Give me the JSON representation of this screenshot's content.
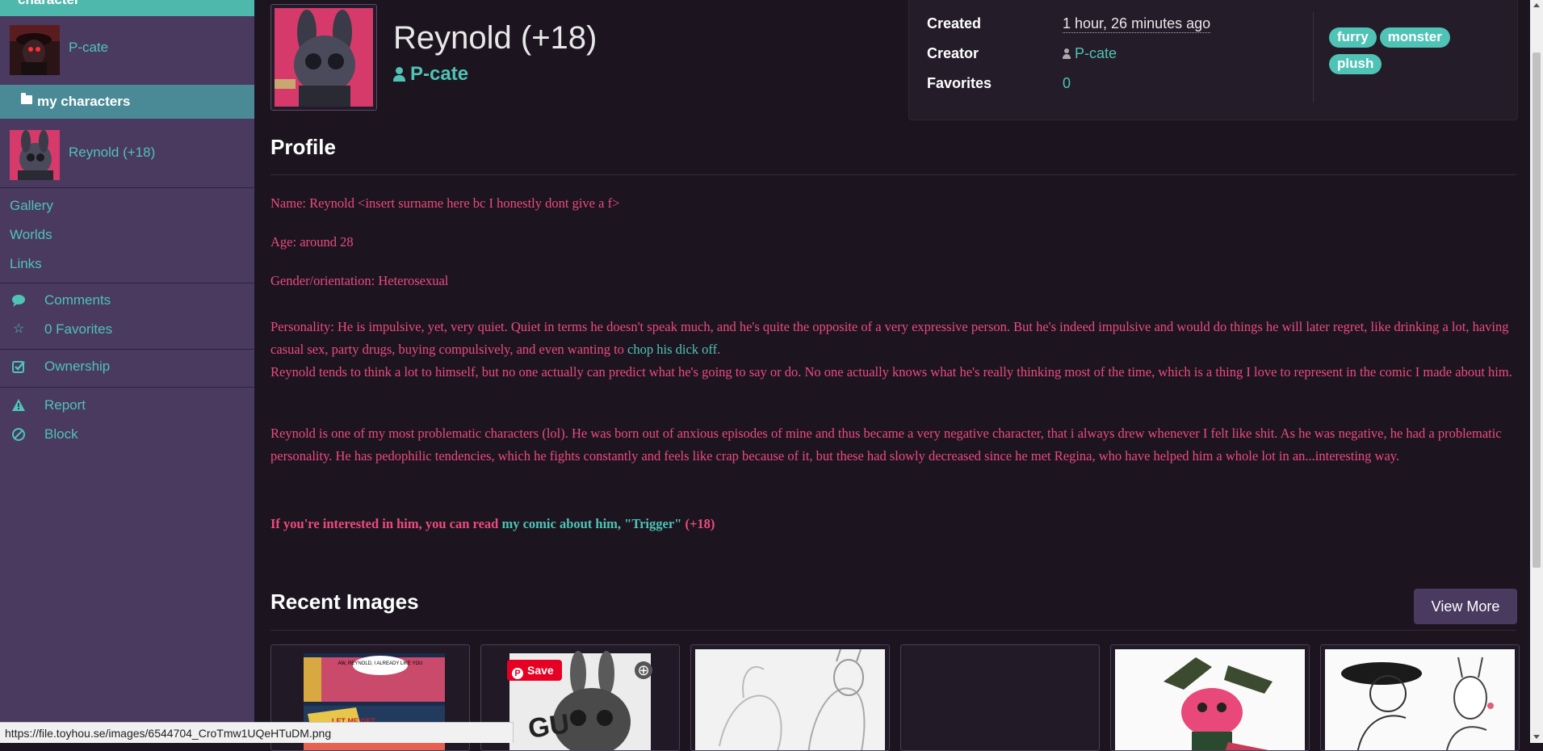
{
  "sidebar": {
    "header_label": "character",
    "owner_name": "P-cate",
    "folder_label": "my characters",
    "character_name": "Reynold (+18)",
    "links": [
      "Gallery",
      "Worlds",
      "Links"
    ],
    "actions": [
      {
        "icon": "comment-icon",
        "label": "Comments"
      },
      {
        "icon": "star-icon",
        "label": "0 Favorites"
      }
    ],
    "ownership": {
      "icon": "checkbox-icon",
      "label": "Ownership"
    },
    "moderation": [
      {
        "icon": "warning-icon",
        "label": "Report"
      },
      {
        "icon": "block-icon",
        "label": "Block"
      }
    ]
  },
  "character": {
    "name": "Reynold (+18)",
    "owner": "P-cate"
  },
  "meta": {
    "created_label": "Created",
    "created_value": "1 hour, 26 minutes ago",
    "creator_label": "Creator",
    "creator_value": "P-cate",
    "favorites_label": "Favorites",
    "favorites_value": "0",
    "tags": [
      "furry",
      "monster",
      "plush"
    ]
  },
  "profile": {
    "title": "Profile",
    "name_line": "Name: Reynold <insert surname here bc I honestly dont give a f>",
    "age_line": "Age: around 28",
    "gender_line": "Gender/orientation: Heterosexual",
    "personality_text": "Personality: He is impulsive, yet, very quiet. Quiet in terms he doesn't speak much, and he's quite the opposite of a very expressive person. But he's indeed impulsive and would do things he will later regret, like drinking a lot, having casual sex, party drugs, buying compulsively, and even wanting to ",
    "personality_link": "chop his dick off",
    "personality_end": ".",
    "personality_2": "Reynold tends to think a lot to himself, but no one actually can predict what he's going to say or do. No one actually knows what he's really thinking most of the time, which is a thing I love to represent in the comic I made about him.",
    "background": "Reynold is one of my most problematic characters (lol). He was born out of anxious episodes of mine and thus became a very negative character, that i always drew whenever I felt like shit. As he was negative, he had a problematic personality. He has pedophilic tendencies, which he fights constantly and feels like crap because of it, but these had slowly decreased since he met Regina, who have helped him a whole lot in an...interesting way.",
    "cta_text": "If you're interested in him, you can read ",
    "cta_link": "my comic about him, \"Trigger\"",
    "cta_end": " (+18)"
  },
  "recent_images": {
    "title": "Recent Images",
    "view_more": "View More",
    "pin_save": "Save",
    "comic_bubble": "AW, REYNOLD, I ALREADY LIKE YOU",
    "comic_caption": "LET ME GET"
  },
  "status_url": "https://file.toyhou.se/images/6544704_CroTmw1UQeHTuDM.png",
  "colors": {
    "sidebar_bg": "#4a3a60",
    "accent_teal": "#4fc3b5",
    "profile_text": "#ee4a7d",
    "page_bg": "#1c1520"
  }
}
